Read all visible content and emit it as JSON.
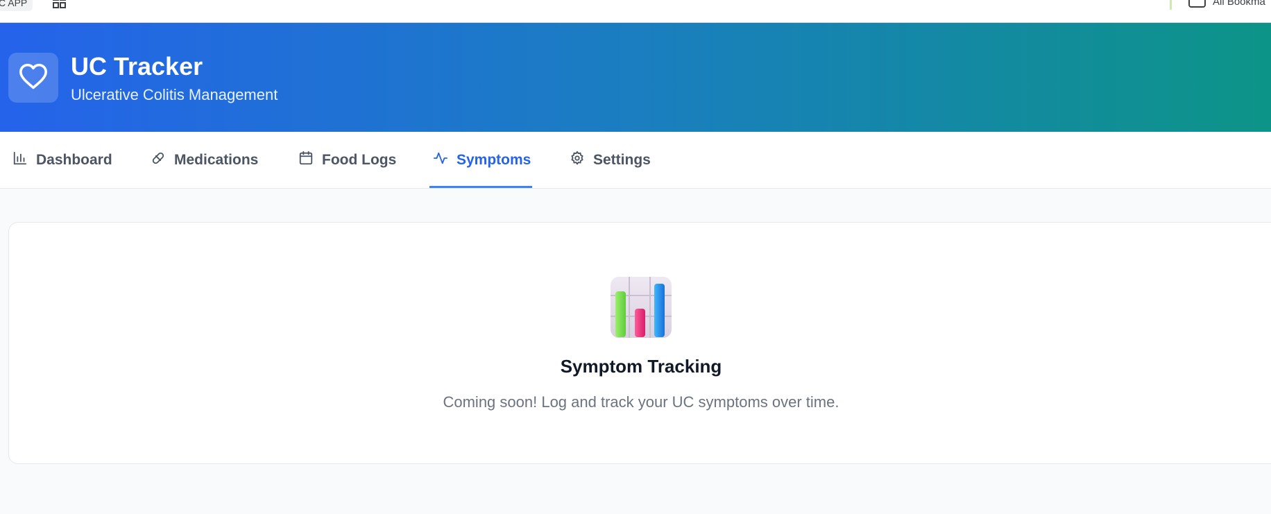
{
  "browser": {
    "bookmark_chip_label": "C APP",
    "all_bookmarks_label": "All Bookma"
  },
  "header": {
    "title": "UC Tracker",
    "subtitle": "Ulcerative Colitis Management"
  },
  "nav": {
    "tabs": [
      {
        "label": "Dashboard",
        "icon": "bar-chart-icon",
        "active": false
      },
      {
        "label": "Medications",
        "icon": "pill-icon",
        "active": false
      },
      {
        "label": "Food Logs",
        "icon": "calendar-icon",
        "active": false
      },
      {
        "label": "Symptoms",
        "icon": "activity-icon",
        "active": true
      },
      {
        "label": "Settings",
        "icon": "gear-icon",
        "active": false
      }
    ]
  },
  "main": {
    "empty_state": {
      "icon": "bar-chart-emoji-icon",
      "title": "Symptom Tracking",
      "description": "Coming soon! Log and track your UC symptoms over time."
    }
  },
  "colors": {
    "header_gradient_start": "#2563eb",
    "header_gradient_end": "#0d9488",
    "active_tab": "#2563eb",
    "inactive_tab": "#4b5563",
    "background": "#f9fafb"
  }
}
